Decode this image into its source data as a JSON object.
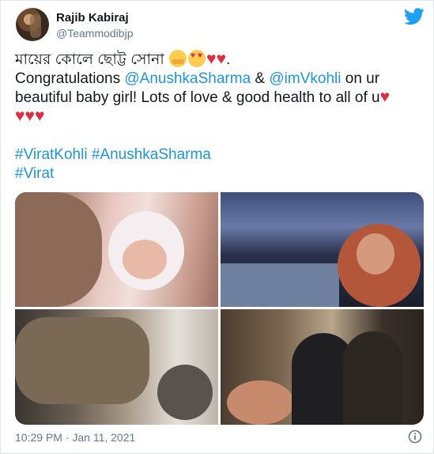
{
  "author": {
    "name": "Rajib Kabiraj",
    "handle": "@Teammodibjp"
  },
  "icons": {
    "brand": "twitter-bird-icon",
    "info": "info-icon",
    "brand_color": "#1da1f2",
    "link_color": "#1b95e0"
  },
  "tweet": {
    "bengali_text": "মায়ের কোলে ছোট্ট সোনা",
    "period": ".",
    "congrats": "Congratulations ",
    "mention_1": "@AnushkaSharma",
    "amp": " & ",
    "mention_2": "@imVkohli",
    "on_ur": " on ur",
    "line_3": "beautiful baby girl! Lots of love & good health to all of u",
    "hashtag_1": "#ViratKohli",
    "hashtag_2": "#AnushkaSharma",
    "hashtag_3": "#Virat"
  },
  "media": {
    "photos": [
      "mother-holding-newborn-photo",
      "couple-selfie-night-photo",
      "baby-feet-table-photo",
      "couple-dinner-photo"
    ]
  },
  "footer": {
    "timestamp": "10:29 PM · Jan 11, 2021"
  }
}
